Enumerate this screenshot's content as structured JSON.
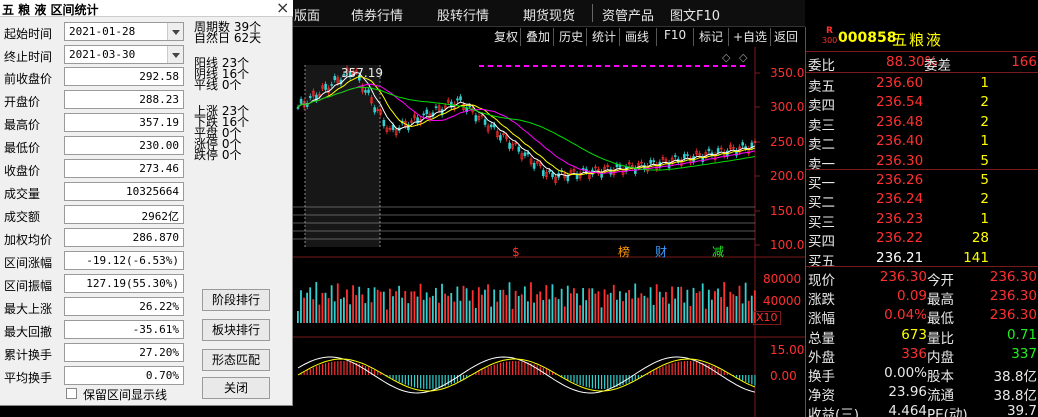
{
  "menu": {
    "items": [
      "版面",
      "债券行情",
      "股转行情",
      "期货现货",
      "资管产品",
      "图文F10"
    ]
  },
  "toolbar": {
    "items": [
      "复权",
      "叠加",
      "历史",
      "统计",
      "画线",
      "F10",
      "标记",
      "+自选",
      "返回"
    ]
  },
  "chart": {
    "peak_label": "357.19",
    "price_axis": [
      "350.0",
      "300.0",
      "250.0",
      "200.0",
      "150.0",
      "100.0"
    ],
    "volume_axis": [
      "80000",
      "40000"
    ],
    "volume_unit": "X10",
    "macd_axis": [
      "15.00",
      "0.00"
    ],
    "events": [
      {
        "mark": "$",
        "color": "#ff3030"
      },
      {
        "mark": "榜",
        "color": "#ff9900"
      },
      {
        "mark": "财",
        "color": "#3a9bff"
      },
      {
        "mark": "减",
        "color": "#20ee20"
      }
    ],
    "colors": {
      "up": "#ff3030",
      "down": "#33d0d0",
      "ma5": "#ffffff",
      "ma10": "#ffff00",
      "ma20": "#ff00ff",
      "ma60": "#00dd00",
      "axis": "#7a1a1a"
    }
  },
  "quote": {
    "badge_top": "R",
    "badge_bottom": "300",
    "code": "000858",
    "name": "五粮液",
    "weibi_label": "委比",
    "weibi_value": "88.30%",
    "weicha_label": "委差",
    "weicha_value": "166",
    "asks": [
      {
        "label": "卖五",
        "price": "236.60",
        "vol": "1"
      },
      {
        "label": "卖四",
        "price": "236.54",
        "vol": "2"
      },
      {
        "label": "卖三",
        "price": "236.48",
        "vol": "2"
      },
      {
        "label": "卖二",
        "price": "236.40",
        "vol": "1"
      },
      {
        "label": "卖一",
        "price": "236.30",
        "vol": "5"
      }
    ],
    "bids": [
      {
        "label": "买一",
        "price": "236.26",
        "vol": "5"
      },
      {
        "label": "买二",
        "price": "236.24",
        "vol": "2"
      },
      {
        "label": "买三",
        "price": "236.23",
        "vol": "1"
      },
      {
        "label": "买四",
        "price": "236.22",
        "vol": "28"
      },
      {
        "label": "买五",
        "price": "236.21",
        "vol": "141"
      }
    ],
    "stats": [
      {
        "l1": "现价",
        "v1": "236.30",
        "c1": "#ff3030",
        "l2": "今开",
        "v2": "236.30",
        "c2": "#ff3030"
      },
      {
        "l1": "涨跌",
        "v1": "0.09",
        "c1": "#ff3030",
        "l2": "最高",
        "v2": "236.30",
        "c2": "#ff3030"
      },
      {
        "l1": "涨幅",
        "v1": "0.04%",
        "c1": "#ff3030",
        "l2": "最低",
        "v2": "236.30",
        "c2": "#ff3030"
      },
      {
        "l1": "总量",
        "v1": "673",
        "c1": "#ffff00",
        "l2": "量比",
        "v2": "0.71",
        "c2": "#20ee20"
      },
      {
        "l1": "外盘",
        "v1": "336",
        "c1": "#ff3030",
        "l2": "内盘",
        "v2": "337",
        "c2": "#20ee20"
      },
      {
        "l1": "换手",
        "v1": "0.00%",
        "c1": "#e8e8e8",
        "l2": "股本",
        "v2": "38.8亿",
        "c2": "#e8e8e8"
      },
      {
        "l1": "净资",
        "v1": "23.96",
        "c1": "#e8e8e8",
        "l2": "流通",
        "v2": "38.8亿",
        "c2": "#e8e8e8"
      },
      {
        "l1": "收益(三)",
        "v1": "4.464",
        "c1": "#e8e8e8",
        "l2": "PE(动)",
        "v2": "39.7",
        "c2": "#e8e8e8"
      }
    ]
  },
  "dialog": {
    "title": "五 粮 液  区间统计",
    "fields": [
      {
        "label": "起始时间",
        "value": "2021-01-28",
        "type": "date"
      },
      {
        "label": "终止时间",
        "value": "2021-03-30",
        "type": "date"
      },
      {
        "label": "前收盘价",
        "value": "292.58"
      },
      {
        "label": "开盘价",
        "value": "288.23"
      },
      {
        "label": "最高价",
        "value": "357.19"
      },
      {
        "label": "最低价",
        "value": "230.00"
      },
      {
        "label": "收盘价",
        "value": "273.46"
      },
      {
        "label": "成交量",
        "value": "10325664"
      },
      {
        "label": "成交额",
        "value": "2962亿"
      },
      {
        "label": "加权均价",
        "value": "286.870"
      },
      {
        "label": "区间涨幅",
        "value": "-19.12(-6.53%)"
      },
      {
        "label": "区间振幅",
        "value": "127.19(55.30%)"
      },
      {
        "label": "最大上涨",
        "value": "26.22%"
      },
      {
        "label": "最大回撤",
        "value": "-35.61%"
      },
      {
        "label": "累计换手",
        "value": "27.20%"
      },
      {
        "label": "平均换手",
        "value": "0.70%"
      }
    ],
    "period_lines": [
      "周期数 39个",
      "自然日 62天"
    ],
    "ma_lines": [
      "阳线 23个",
      "阴线 16个",
      "平线 0个"
    ],
    "up_lines": [
      "上涨 23个",
      "下跌 16个",
      "平盘 0个",
      "涨停 0个",
      "跌停 0个"
    ],
    "buttons": [
      "阶段排行",
      "板块排行",
      "形态匹配",
      "关闭"
    ],
    "checkbox_label": "保留区间显示线"
  }
}
